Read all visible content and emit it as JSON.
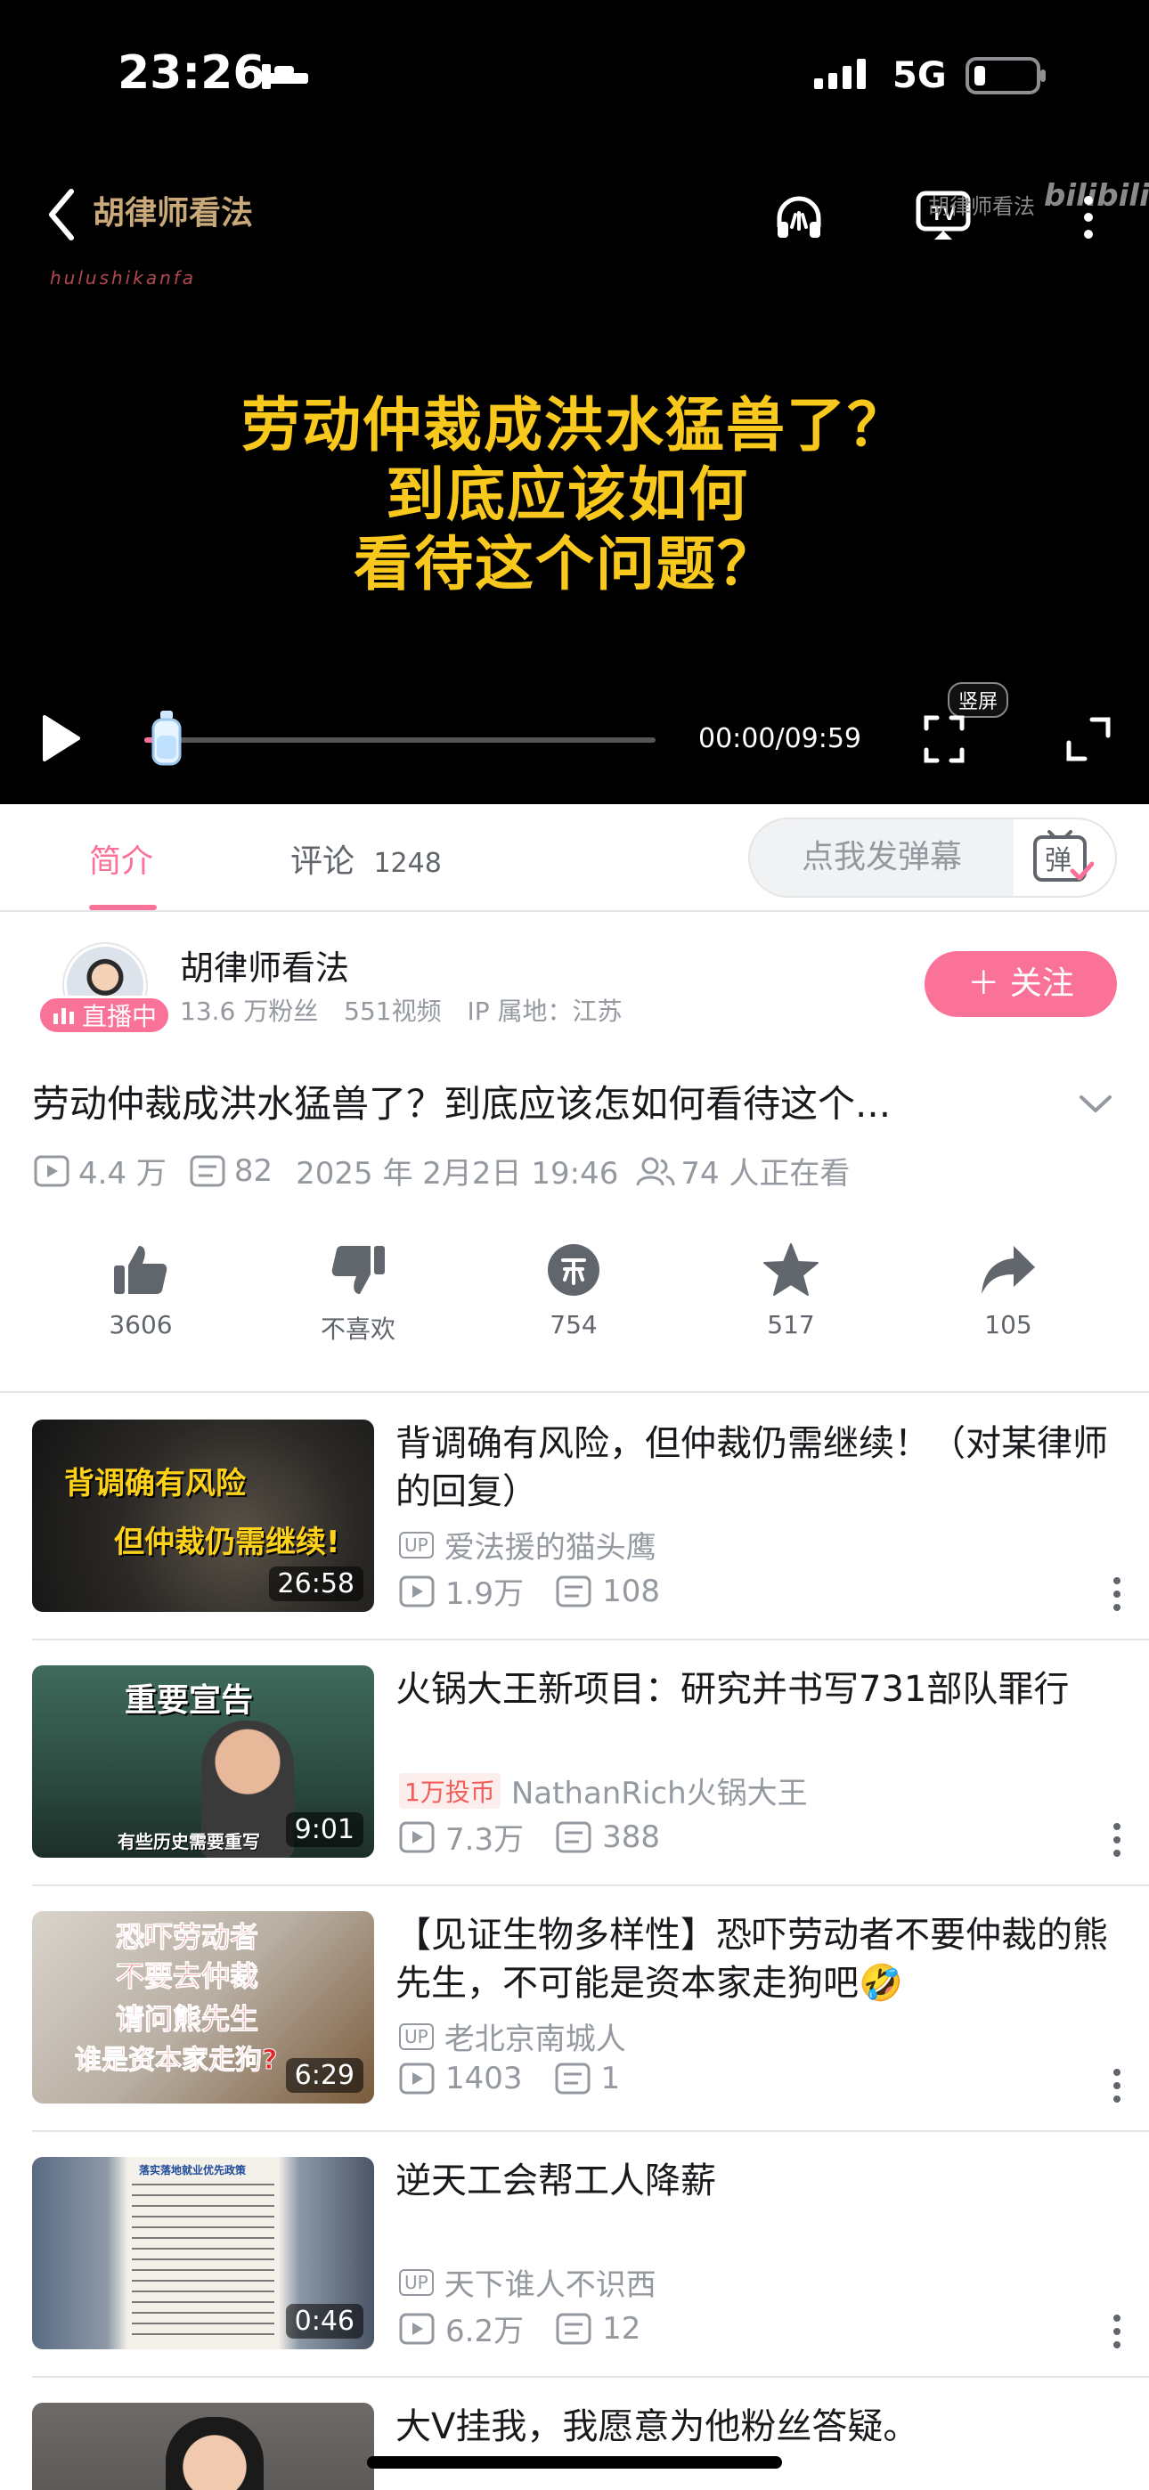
{
  "status_bar": {
    "time": "23:26",
    "network": "5G"
  },
  "player": {
    "channel_watermark": "胡律师看法",
    "channel_watermark_sub": "hulushikanfa",
    "corner_watermark": "胡律师看法",
    "video_title_lines": [
      "劳动仲裁成洪水猛兽了？",
      "到底应该如何",
      "看待这个问题？"
    ],
    "time_display": "00:00/09:59",
    "portrait_label": "竖屏",
    "progress": 0.0
  },
  "tabs": {
    "intro": "简介",
    "comments": "评论",
    "comments_count": "1248",
    "danmaku_placeholder": "点我发弹幕",
    "danmaku_icon_label": "弹"
  },
  "author": {
    "name": "胡律师看法",
    "live_badge": "直播中",
    "fans": "13.6 万粉丝",
    "videos": "551视频",
    "ip": "IP 属地：江苏",
    "follow": "＋ 关注"
  },
  "video": {
    "title": "劳动仲裁成洪水猛兽了？到底应该怎如何看待这个...",
    "views": "4.4 万",
    "danmaku": "82",
    "date": "2025 年 2月2日 19:46",
    "watching": "74 人正在看"
  },
  "actions": [
    {
      "icon": "like-icon",
      "label": "3606"
    },
    {
      "icon": "dislike-icon",
      "label": "不喜欢"
    },
    {
      "icon": "coin-icon",
      "label": "754"
    },
    {
      "icon": "favorite-icon",
      "label": "517"
    },
    {
      "icon": "share-icon",
      "label": "105"
    }
  ],
  "recommendations": [
    {
      "title": "背调确有风险，但仲裁仍需继续！（对某律师的回复）",
      "thumb_lines": [
        "背调确有风险",
        "但仲裁仍需继续!"
      ],
      "duration": "26:58",
      "badge": "UP",
      "author": "爱法援的猫头鹰",
      "views": "1.9万",
      "comments": "108"
    },
    {
      "title": "火锅大王新项目：研究并书写731部队罪行",
      "thumb_lines": [
        "重要宣告",
        "有些历史需要重写"
      ],
      "duration": "9:01",
      "badge": "1万投币",
      "author": "NathanRich火锅大王",
      "views": "7.3万",
      "comments": "388"
    },
    {
      "title": "【见证生物多样性】恐吓劳动者不要仲裁的熊先生，不可能是资本家走狗吧🤣",
      "thumb_lines": [
        "恐吓劳动者",
        "不要去仲裁",
        "请问熊先生",
        "谁是资本家走狗?"
      ],
      "duration": "6:29",
      "badge": "UP",
      "author": "老北京南城人",
      "views": "1403",
      "comments": "1"
    },
    {
      "title": "逆天工会帮工人降薪",
      "thumb_lines": [
        "落实落地就业优先政策"
      ],
      "duration": "0:46",
      "badge": "UP",
      "author": "天下谁人不识西",
      "views": "6.2万",
      "comments": "12"
    },
    {
      "title": "大V挂我，我愿意为他粉丝答疑。",
      "thumb_lines": [],
      "duration": "",
      "badge": "",
      "author": "",
      "views": "",
      "comments": ""
    }
  ],
  "colors": {
    "accent": "#fb7299",
    "title_yellow": "#f8c91c",
    "muted": "#9499a0"
  }
}
